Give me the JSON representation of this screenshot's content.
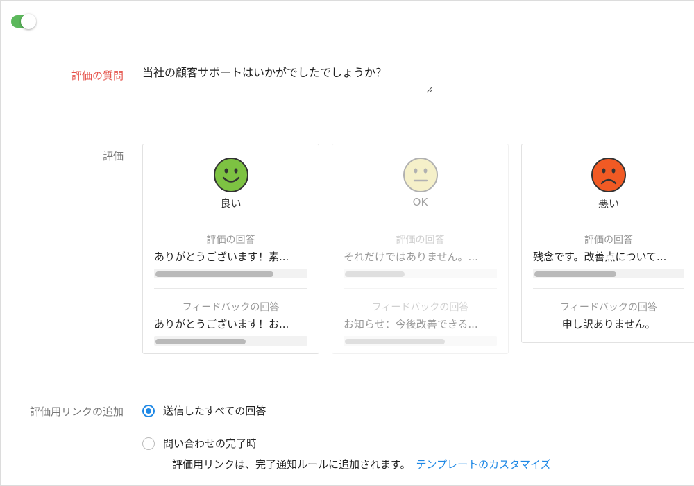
{
  "header": {
    "toggle_on": true,
    "toggle_color": "#5cb85c"
  },
  "form": {
    "question_label": "評価の質問",
    "question_value": "当社の顧客サポートはいかがでしたでしょうか？",
    "rating_label": "評価",
    "link_label": "評価用リンクの追加"
  },
  "ratings": [
    {
      "name": "良い",
      "face": "happy-face-icon",
      "face_color": "#7dc242",
      "muted": false,
      "response_title": "評価の回答",
      "response_text": "ありがとうございます！素...",
      "response_progress": 0.78,
      "feedback_title": "フィードバックの回答",
      "feedback_text": "ありがとうございます！お...",
      "feedback_progress": 0.6
    },
    {
      "name": "OK",
      "face": "neutral-face-icon",
      "face_color": "#e9e08a",
      "muted": true,
      "response_title": "評価の回答",
      "response_text": "それだけではありません。...",
      "response_progress": 0.4,
      "feedback_title": "フィードバックの回答",
      "feedback_text": "お知らせ：今後改善できる...",
      "feedback_progress": 0.66
    },
    {
      "name": "悪い",
      "face": "sad-face-icon",
      "face_color": "#f15a24",
      "muted": false,
      "response_title": "評価の回答",
      "response_text": "残念です。改善点について...",
      "response_progress": 0.52,
      "feedback_title": "フィードバックの回答",
      "feedback_text": "申し訳ありません。"
    }
  ],
  "link_options": [
    {
      "label": "送信したすべての回答",
      "checked": true
    },
    {
      "label": "問い合わせの完了時",
      "checked": false
    }
  ],
  "note": {
    "text": "評価用リンクは、完了通知ルールに追加されます。",
    "link_text": "テンプレートのカスタマイズ",
    "link_color": "#1e88e5"
  }
}
